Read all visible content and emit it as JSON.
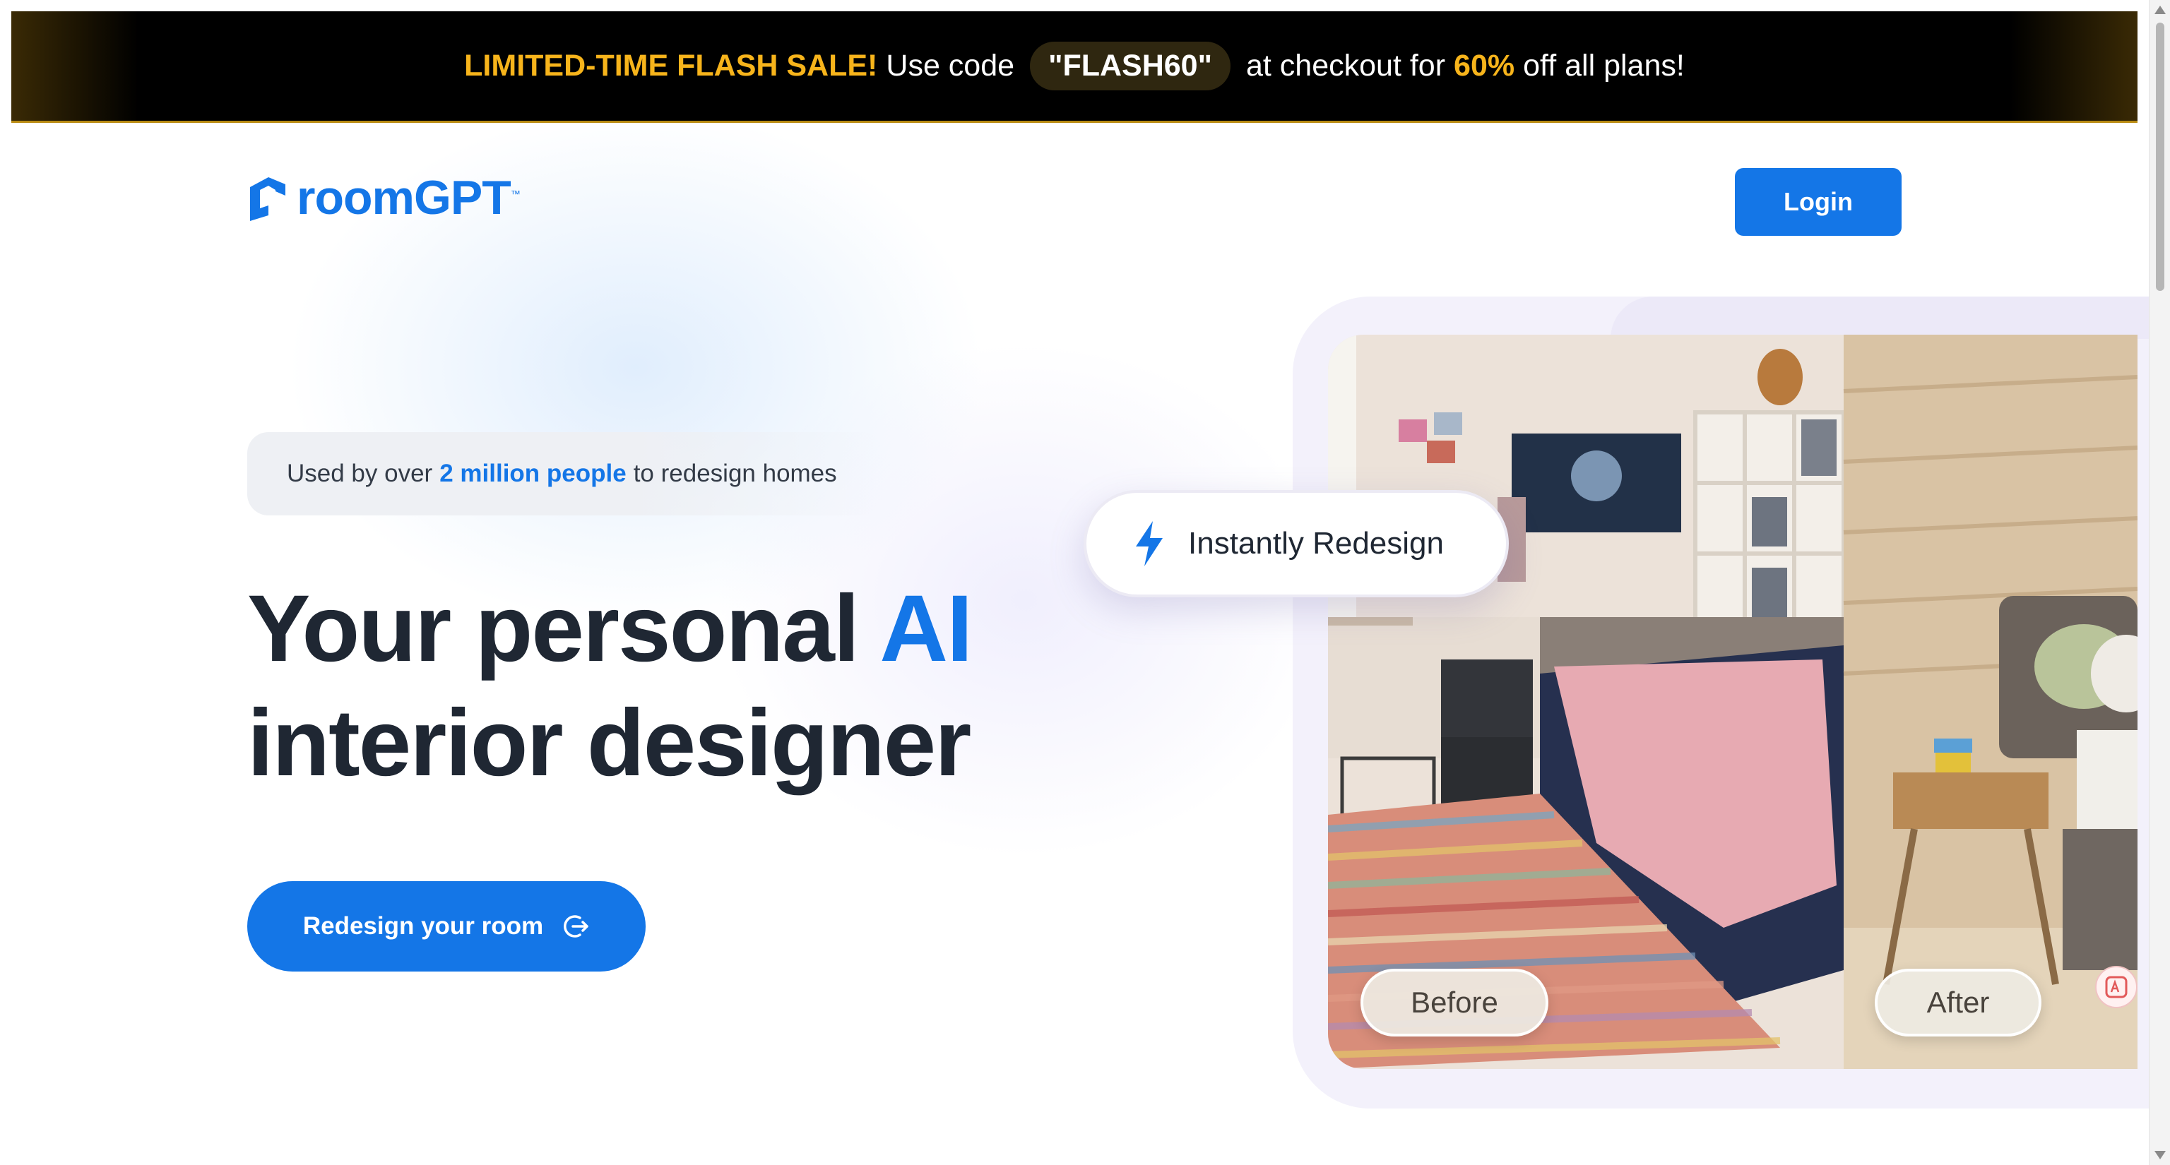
{
  "promo": {
    "headline": "LIMITED-TIME FLASH SALE!",
    "use_code": "Use code",
    "code": "\"FLASH60\"",
    "at_checkout": "at checkout for",
    "percent": "60%",
    "tail": "off all plans!"
  },
  "nav": {
    "logo_text": "roomGPT",
    "logo_tm": "™",
    "login_label": "Login"
  },
  "hero": {
    "usedby_prefix": "Used by over",
    "usedby_highlight": "2 million people",
    "usedby_suffix": "to redesign homes",
    "headline_part1": "Your personal",
    "headline_ai": "AI",
    "headline_line2": "interior designer",
    "cta_label": "Redesign your room"
  },
  "showcase": {
    "badge_label": "Instantly Redesign",
    "before_label": "Before",
    "after_label": "After"
  },
  "colors": {
    "brand_blue": "#1476e7",
    "promo_gold": "#f7b41b",
    "promo_bg": "#000000",
    "text_dark": "#1f2733"
  },
  "icons": {
    "logo": "house-logo-icon",
    "cta": "arrow-right-circle-icon",
    "badge": "lightning-bolt-icon",
    "translate": "translate-icon"
  }
}
